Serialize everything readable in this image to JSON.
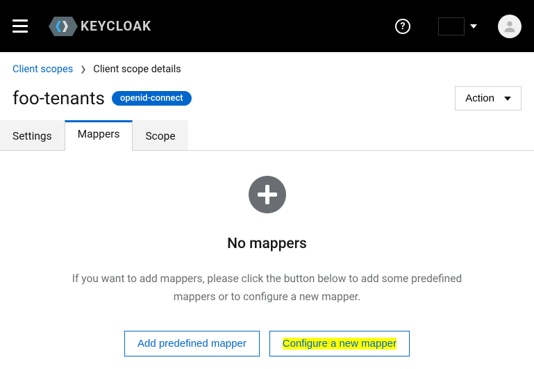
{
  "header": {
    "logo_text": "KEYCLOAK"
  },
  "breadcrumb": {
    "parent": "Client scopes",
    "current": "Client scope details"
  },
  "page": {
    "title": "foo-tenants",
    "protocol_badge": "openid-connect",
    "action_label": "Action"
  },
  "tabs": [
    {
      "label": "Settings",
      "active": false
    },
    {
      "label": "Mappers",
      "active": true
    },
    {
      "label": "Scope",
      "active": false
    }
  ],
  "empty_state": {
    "heading": "No mappers",
    "description": "If you want to add mappers, please click the button below to add some predefined mappers or to configure a new mapper.",
    "add_predefined_label": "Add predefined mapper",
    "configure_new_label": "Configure a new mapper"
  }
}
